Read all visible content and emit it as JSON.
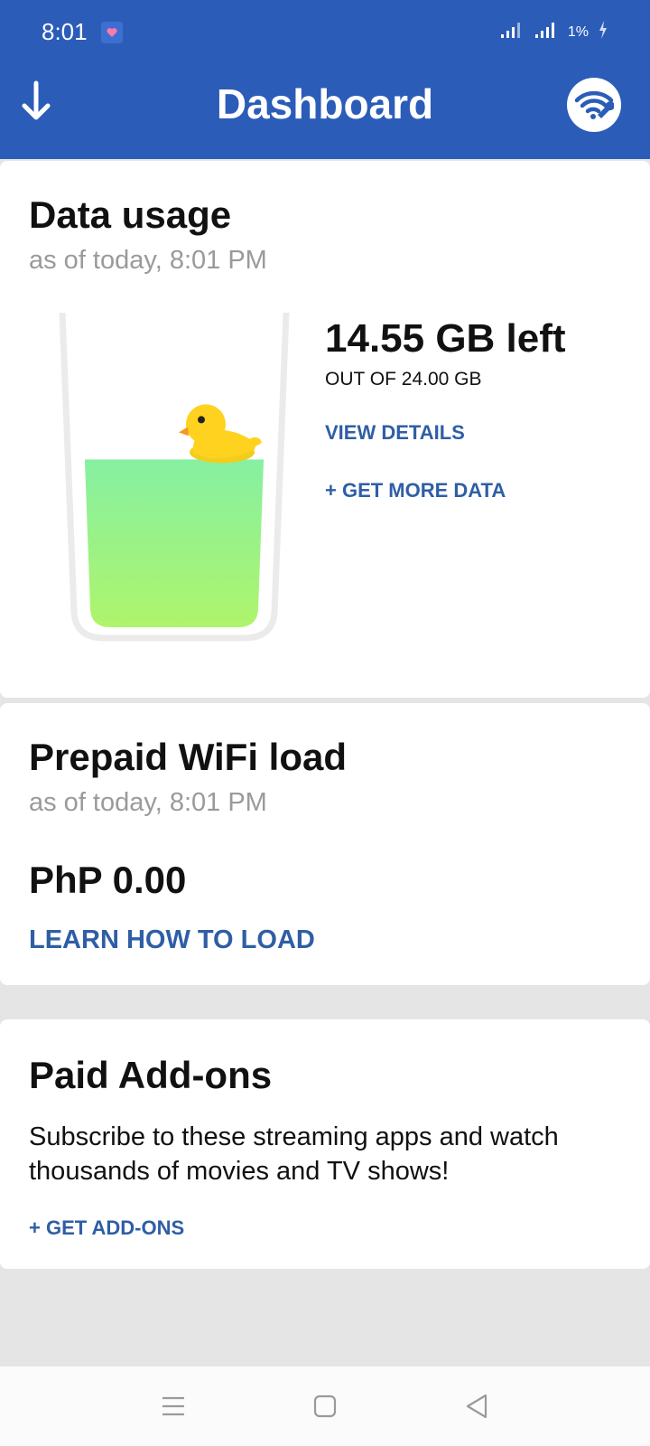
{
  "status_bar": {
    "time": "8:01",
    "battery": "1%"
  },
  "app_bar": {
    "title": "Dashboard",
    "left_icon": "arrow-down-icon",
    "right_icon": "wifi-settings-icon"
  },
  "data_usage": {
    "title": "Data usage",
    "subtitle": "as of today, 8:01 PM",
    "remaining": "14.55 GB left",
    "total": "OUT OF 24.00 GB",
    "remaining_fraction": 0.606,
    "view_details": "VIEW DETAILS",
    "get_more": "+ GET MORE DATA"
  },
  "wifi_load": {
    "title": "Prepaid WiFi load",
    "subtitle": "as of today, 8:01 PM",
    "amount": "PhP 0.00",
    "learn_link": "LEARN HOW TO LOAD"
  },
  "addons": {
    "title": "Paid Add-ons",
    "description": "Subscribe to these streaming apps and watch thousands of movies and TV shows!",
    "link": "+ GET ADD-ONS"
  },
  "colors": {
    "brand": "#2b5cb8",
    "link": "#2f5ea5",
    "liquid_top": "#86f0a2",
    "liquid_bottom": "#b4f564"
  }
}
